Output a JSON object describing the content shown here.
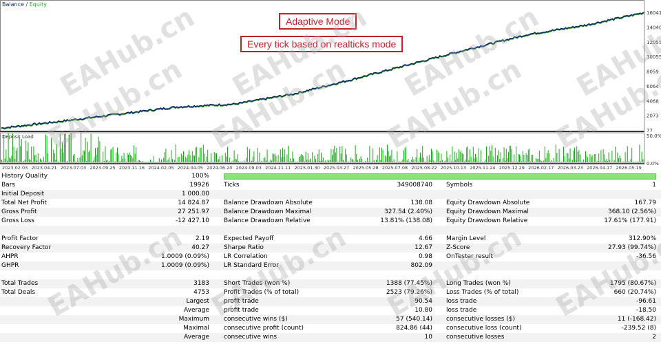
{
  "chart": {
    "legend_balance": "Balance",
    "legend_sep": " / ",
    "legend_equity": "Equity",
    "y_labels": [
      "16041",
      "14040",
      "12055",
      "10055",
      "8059",
      "6064",
      "4068",
      "2073",
      "77"
    ],
    "deposit_label": "Deposit Load",
    "deposit_top": "50.0%",
    "deposit_bottom": "0.0%",
    "x_labels": [
      "2023.02.03",
      "2023.04.21",
      "2023.07.03",
      "2023.09.25",
      "2023.11.16",
      "2024.02.05",
      "2024.04.05",
      "2024.06.20",
      "2024.09.03",
      "2024.11.11",
      "2025.01.30",
      "2025.03.27",
      "2025.05.28",
      "2025.07.08",
      "2025.08.22",
      "2025.10.13",
      "2025.11.24",
      "2025.12.29",
      "2026.02.17",
      "2026.03.23",
      "2026.04.17",
      "2026.05.19"
    ],
    "balance_color": "#0c2a5e",
    "equity_color": "#2e9e2e",
    "load_color": "#1aa71a"
  },
  "chart_data": {
    "type": "line",
    "title": "",
    "series": [
      {
        "name": "Balance",
        "x": [
          "2023.02.03",
          "2023.07.03",
          "2023.11.16",
          "2024.04.05",
          "2024.06.20",
          "2024.11.11",
          "2025.03.27",
          "2025.07.08",
          "2025.10.13",
          "2025.12.29",
          "2026.03.23",
          "2026.05.19"
        ],
        "values": [
          77,
          1000,
          2000,
          3000,
          3400,
          4800,
          6800,
          8900,
          11000,
          13000,
          14300,
          16041
        ]
      }
    ],
    "ylim": [
      77,
      16041
    ]
  },
  "overlay": {
    "mode": "Adaptive Mode",
    "ticks_mode": "Every tick based on realticks mode"
  },
  "watermark": "EAHub.cn",
  "stats": {
    "history_quality_label": "History Quality",
    "history_quality_value": "100%",
    "history_quality_fill": 1.0,
    "rows": [
      {
        "c1l": "Bars",
        "c1v": "19926",
        "c2l": "Ticks",
        "c2v": "349008740",
        "c3l": "Symbols",
        "c3v": "1"
      },
      {
        "c1l": "Initial Deposit",
        "c1v": "1 000.00",
        "c2l": "",
        "c2v": "",
        "c3l": "",
        "c3v": ""
      },
      {
        "c1l": "Total Net Profit",
        "c1v": "14 824.87",
        "c2l": "Balance Drawdown Absolute",
        "c2v": "138.08",
        "c3l": "Equity Drawdown Absolute",
        "c3v": "167.79"
      },
      {
        "c1l": "Gross Profit",
        "c1v": "27 251.97",
        "c2l": "Balance Drawdown Maximal",
        "c2v": "327.54 (2.40%)",
        "c3l": "Equity Drawdown Maximal",
        "c3v": "368.10 (2.56%)"
      },
      {
        "c1l": "Gross Loss",
        "c1v": "-12 427.10",
        "c2l": "Balance Drawdown Relative",
        "c2v": "13.81% (138.08)",
        "c3l": "Equity Drawdown Relative",
        "c3v": "17.61% (177.91)"
      },
      {
        "c1l": "",
        "c1v": "",
        "c2l": "",
        "c2v": "",
        "c3l": "",
        "c3v": ""
      },
      {
        "c1l": "Profit Factor",
        "c1v": "2.19",
        "c2l": "Expected Payoff",
        "c2v": "4.66",
        "c3l": "Margin Level",
        "c3v": "312.90%"
      },
      {
        "c1l": "Recovery Factor",
        "c1v": "40.27",
        "c2l": "Sharpe Ratio",
        "c2v": "12.67",
        "c3l": "Z-Score",
        "c3v": "27.93 (99.74%)"
      },
      {
        "c1l": "AHPR",
        "c1v": "1.0009 (0.09%)",
        "c2l": "LR Correlation",
        "c2v": "0.98",
        "c3l": "OnTester result",
        "c3v": "-36.56"
      },
      {
        "c1l": "GHPR",
        "c1v": "1.0009 (0.09%)",
        "c2l": "LR Standard Error",
        "c2v": "802.09",
        "c3l": "",
        "c3v": ""
      },
      {
        "c1l": "",
        "c1v": "",
        "c2l": "",
        "c2v": "",
        "c3l": "",
        "c3v": ""
      },
      {
        "c1l": "Total Trades",
        "c1v": "3183",
        "c2l": "Short Trades (won %)",
        "c2v": "1388 (77.45%)",
        "c3l": "Long Trades (won %)",
        "c3v": "1795 (80.67%)"
      },
      {
        "c1l": "Total Deals",
        "c1v": "4753",
        "c2l": "Profit Trades (% of total)",
        "c2v": "2523 (79.26%)",
        "c3l": "Loss Trades (% of total)",
        "c3v": "660 (20.74%)"
      },
      {
        "c1l": "",
        "c1v": "Largest",
        "c2l": "profit trade",
        "c2v": "90.54",
        "c3l": "loss trade",
        "c3v": "-96.61"
      },
      {
        "c1l": "",
        "c1v": "Average",
        "c2l": "profit trade",
        "c2v": "10.80",
        "c3l": "loss trade",
        "c3v": "-18.50"
      },
      {
        "c1l": "",
        "c1v": "Maximum",
        "c2l": "consecutive wins ($)",
        "c2v": "57 (540.14)",
        "c3l": "consecutive losses ($)",
        "c3v": "11 (-168.42)"
      },
      {
        "c1l": "",
        "c1v": "Maximal",
        "c2l": "consecutive profit (count)",
        "c2v": "824.86 (44)",
        "c3l": "consecutive loss (count)",
        "c3v": "-239.52 (8)"
      },
      {
        "c1l": "",
        "c1v": "Average",
        "c2l": "consecutive wins",
        "c2v": "10",
        "c3l": "consecutive losses",
        "c3v": "2"
      }
    ]
  }
}
